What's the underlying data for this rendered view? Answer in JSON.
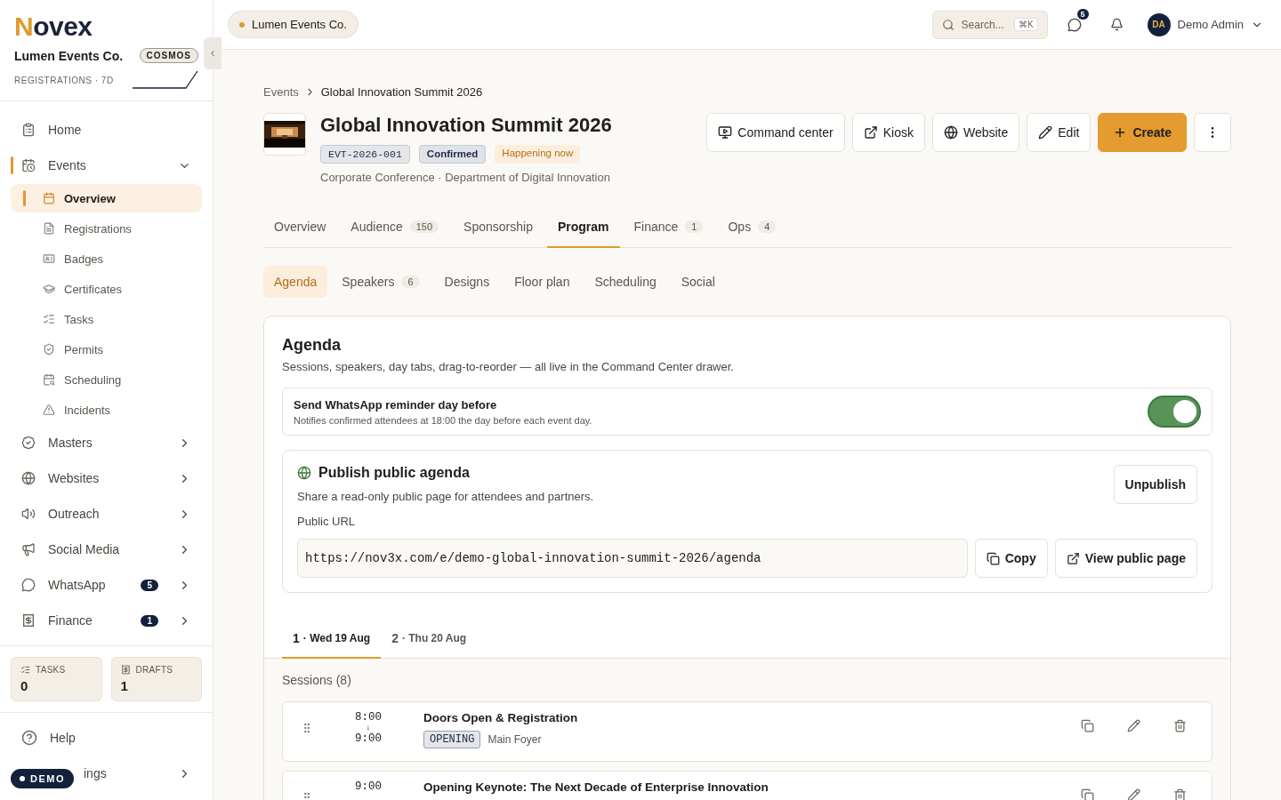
{
  "brand": {
    "mark": "N",
    "rest": "ovex"
  },
  "org": {
    "name": "Lumen Events Co.",
    "plan": "COSMOS",
    "metric": "REGISTRATIONS · 7D"
  },
  "nav": [
    {
      "label": "Home",
      "selected": false
    },
    {
      "label": "Events",
      "selected": true,
      "expanded": true,
      "children": [
        {
          "label": "Overview",
          "selected": true
        },
        {
          "label": "Registrations",
          "selected": false
        },
        {
          "label": "Badges",
          "selected": false
        },
        {
          "label": "Certificates",
          "selected": false
        },
        {
          "label": "Tasks",
          "selected": false
        },
        {
          "label": "Permits",
          "selected": false
        },
        {
          "label": "Scheduling",
          "selected": false
        },
        {
          "label": "Incidents",
          "selected": false
        }
      ]
    },
    {
      "label": "Masters",
      "selected": false,
      "expanded": false
    },
    {
      "label": "Websites",
      "selected": false,
      "expanded": false
    },
    {
      "label": "Outreach",
      "selected": false,
      "expanded": false
    },
    {
      "label": "Social Media",
      "selected": false,
      "expanded": false
    },
    {
      "label": "WhatsApp",
      "selected": false,
      "expanded": false,
      "badge": "5"
    },
    {
      "label": "Finance",
      "selected": false,
      "expanded": false,
      "badge": "1"
    }
  ],
  "stats": [
    {
      "label": "TASKS",
      "value": "0"
    },
    {
      "label": "DRAFTS",
      "value": "1"
    }
  ],
  "footer_nav": [
    {
      "label": "Help"
    },
    {
      "label": "ings"
    }
  ],
  "demo_badge": "DEMO",
  "topbar": {
    "org": "Lumen Events Co.",
    "search": {
      "placeholder": "Search...",
      "shortcut": "⌘K"
    },
    "messages_badge": "5",
    "user": {
      "initials": "DA",
      "name": "Demo Admin"
    }
  },
  "breadcrumb": [
    "Events",
    "Global Innovation Summit 2026"
  ],
  "event": {
    "title": "Global Innovation Summit 2026",
    "code": "EVT-2026-001",
    "status": "Confirmed",
    "live": "Happening now",
    "subtitle": "Corporate Conference · Department of Digital Innovation"
  },
  "actions": [
    {
      "label": "Command center",
      "kind": "plain"
    },
    {
      "label": "Kiosk",
      "kind": "plain"
    },
    {
      "label": "Website",
      "kind": "plain"
    },
    {
      "label": "Edit",
      "kind": "plain"
    },
    {
      "label": "Create",
      "kind": "primary"
    }
  ],
  "tabs": [
    {
      "label": "Overview",
      "selected": false
    },
    {
      "label": "Audience",
      "count": "150",
      "selected": false
    },
    {
      "label": "Sponsorship",
      "selected": false
    },
    {
      "label": "Program",
      "selected": true
    },
    {
      "label": "Finance",
      "count": "1",
      "selected": false
    },
    {
      "label": "Ops",
      "count": "4",
      "selected": false
    }
  ],
  "subtabs": [
    {
      "label": "Agenda",
      "selected": true
    },
    {
      "label": "Speakers",
      "count": "6",
      "selected": false
    },
    {
      "label": "Designs",
      "selected": false
    },
    {
      "label": "Floor plan",
      "selected": false
    },
    {
      "label": "Scheduling",
      "selected": false
    },
    {
      "label": "Social",
      "selected": false
    }
  ],
  "agenda": {
    "title": "Agenda",
    "description": "Sessions, speakers, day tabs, drag-to-reorder — all live in the Command Center drawer.",
    "reminder": {
      "title": "Send WhatsApp reminder day before",
      "description": "Notifies confirmed attendees at 18:00 the day before each event day.",
      "on": true
    },
    "publish": {
      "title": "Publish public agenda",
      "description": "Share a read-only public page for attendees and partners.",
      "unpublish": "Unpublish",
      "url_label": "Public URL",
      "url": "https://nov3x.com/e/demo-global-innovation-summit-2026/agenda",
      "copy": "Copy",
      "view": "View public page"
    },
    "days": [
      {
        "number": "1",
        "label": "· Wed 19 Aug",
        "selected": true
      },
      {
        "number": "2",
        "label": "· Thu 20 Aug",
        "selected": false
      }
    ],
    "sessions_label": "Sessions (8)",
    "sessions": [
      {
        "start": "8:00",
        "arrow": "↓",
        "end": "9:00",
        "title": "Doors Open & Registration",
        "tag": "OPENING",
        "room": "Main Foyer"
      },
      {
        "start": "9:00",
        "title": "Opening Keynote: The Next Decade of Enterprise Innovation"
      }
    ]
  }
}
